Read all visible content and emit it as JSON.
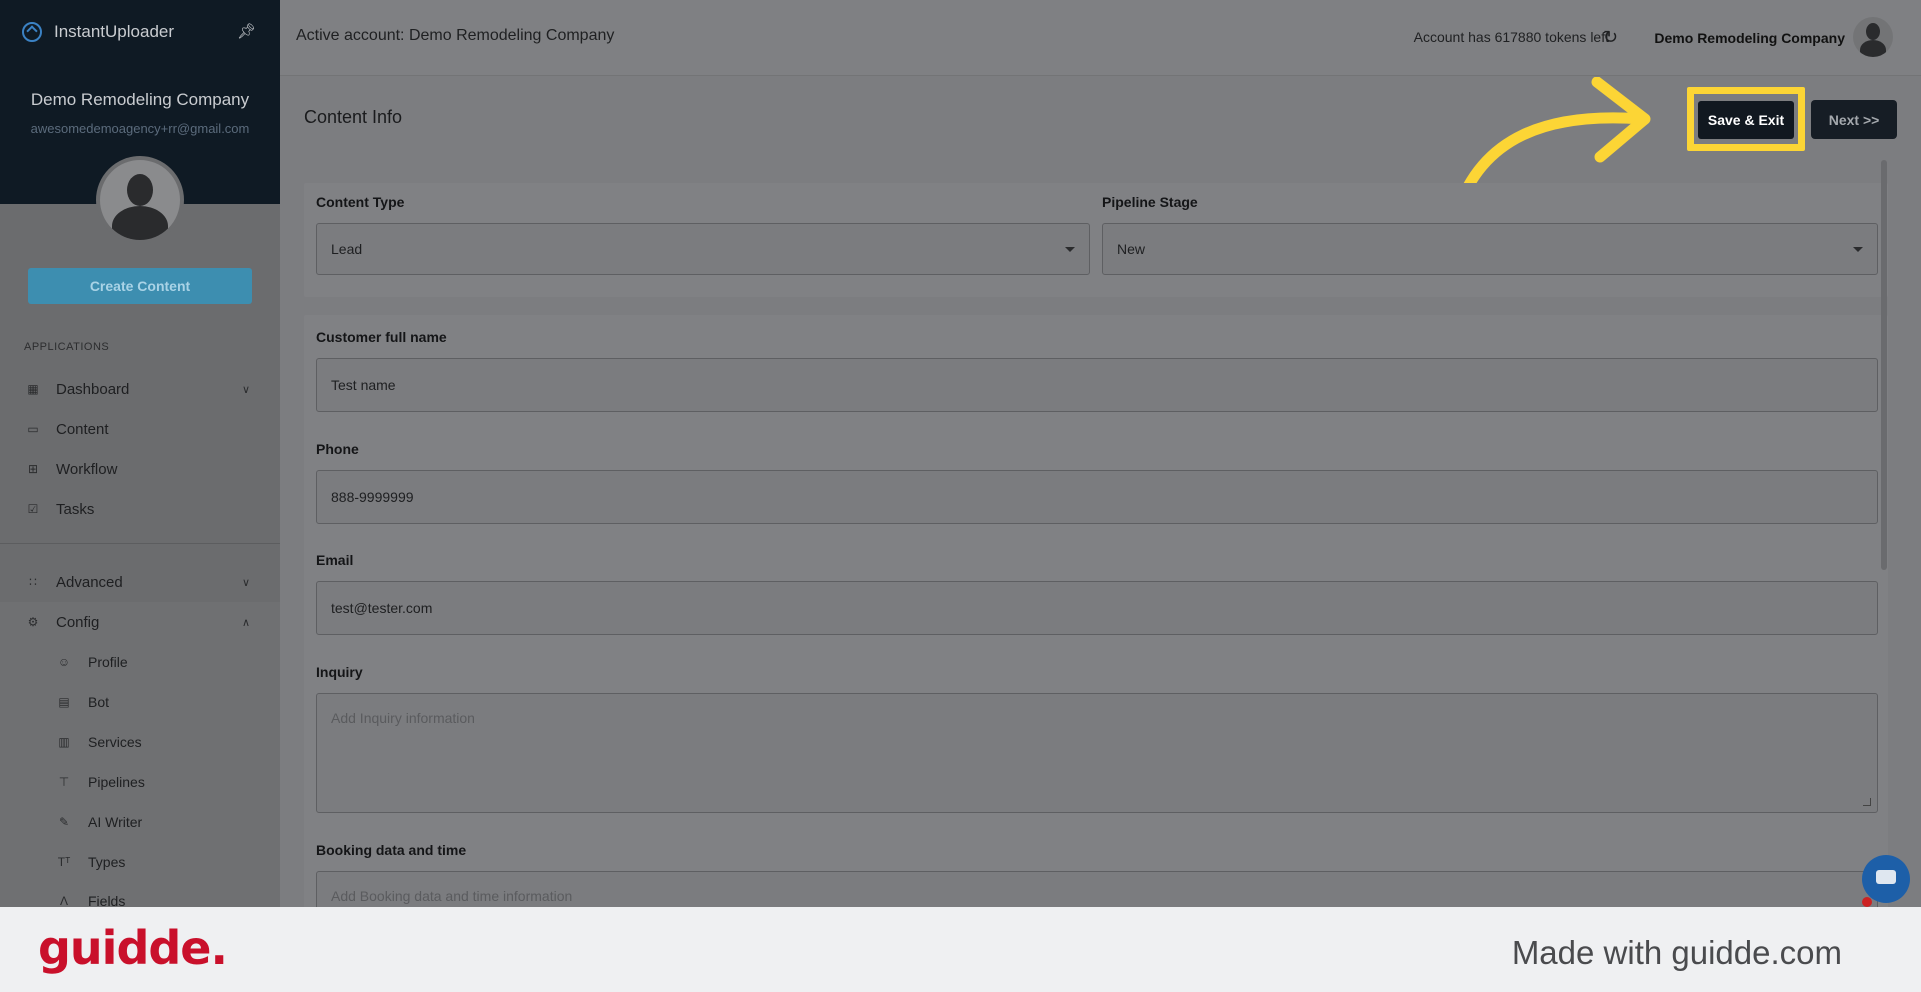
{
  "sidebar": {
    "brand": "InstantUploader",
    "company": "Demo Remodeling Company",
    "email": "awesomedemoagency+rr@gmail.com",
    "create_button": "Create Content",
    "section_label": "APPLICATIONS",
    "items": [
      {
        "label": "Dashboard",
        "icon": "dashboard-icon"
      },
      {
        "label": "Content",
        "icon": "folder-icon"
      },
      {
        "label": "Workflow",
        "icon": "grid-icon"
      },
      {
        "label": "Tasks",
        "icon": "checkbox-icon"
      },
      {
        "label": "Advanced",
        "icon": "apps-icon"
      },
      {
        "label": "Config",
        "icon": "gear-icon"
      }
    ],
    "config_items": [
      {
        "label": "Profile",
        "icon": "person-icon"
      },
      {
        "label": "Bot",
        "icon": "chat-icon"
      },
      {
        "label": "Services",
        "icon": "building-icon"
      },
      {
        "label": "Pipelines",
        "icon": "pipeline-icon"
      },
      {
        "label": "AI Writer",
        "icon": "pencil-icon"
      },
      {
        "label": "Types",
        "icon": "text-type-icon"
      },
      {
        "label": "Fields",
        "icon": "field-icon"
      }
    ]
  },
  "topbar": {
    "active_account": "Active account: Demo Remodeling Company",
    "tokens": "Account has 617880 tokens left",
    "user_name": "Demo Remodeling Company"
  },
  "main": {
    "title": "Content Info",
    "save_exit": "Save & Exit",
    "next": "Next >>",
    "form": {
      "content_type_label": "Content Type",
      "content_type_value": "Lead",
      "pipeline_stage_label": "Pipeline Stage",
      "pipeline_stage_value": "New",
      "customer_label": "Customer full name",
      "customer_value": "Test name",
      "phone_label": "Phone",
      "phone_value": "888-9999999",
      "email_label": "Email",
      "email_value": "test@tester.com",
      "inquiry_label": "Inquiry",
      "inquiry_placeholder": "Add Inquiry information",
      "booking_label": "Booking data and time",
      "booking_placeholder": "Add Booking data and time information"
    }
  },
  "footer": {
    "logo": "guidde.",
    "made_with": "Made with guidde.com"
  },
  "colors": {
    "highlight": "#fcd535",
    "guidde_red": "#c9102b",
    "sidebar_head": "#0f1a24"
  }
}
